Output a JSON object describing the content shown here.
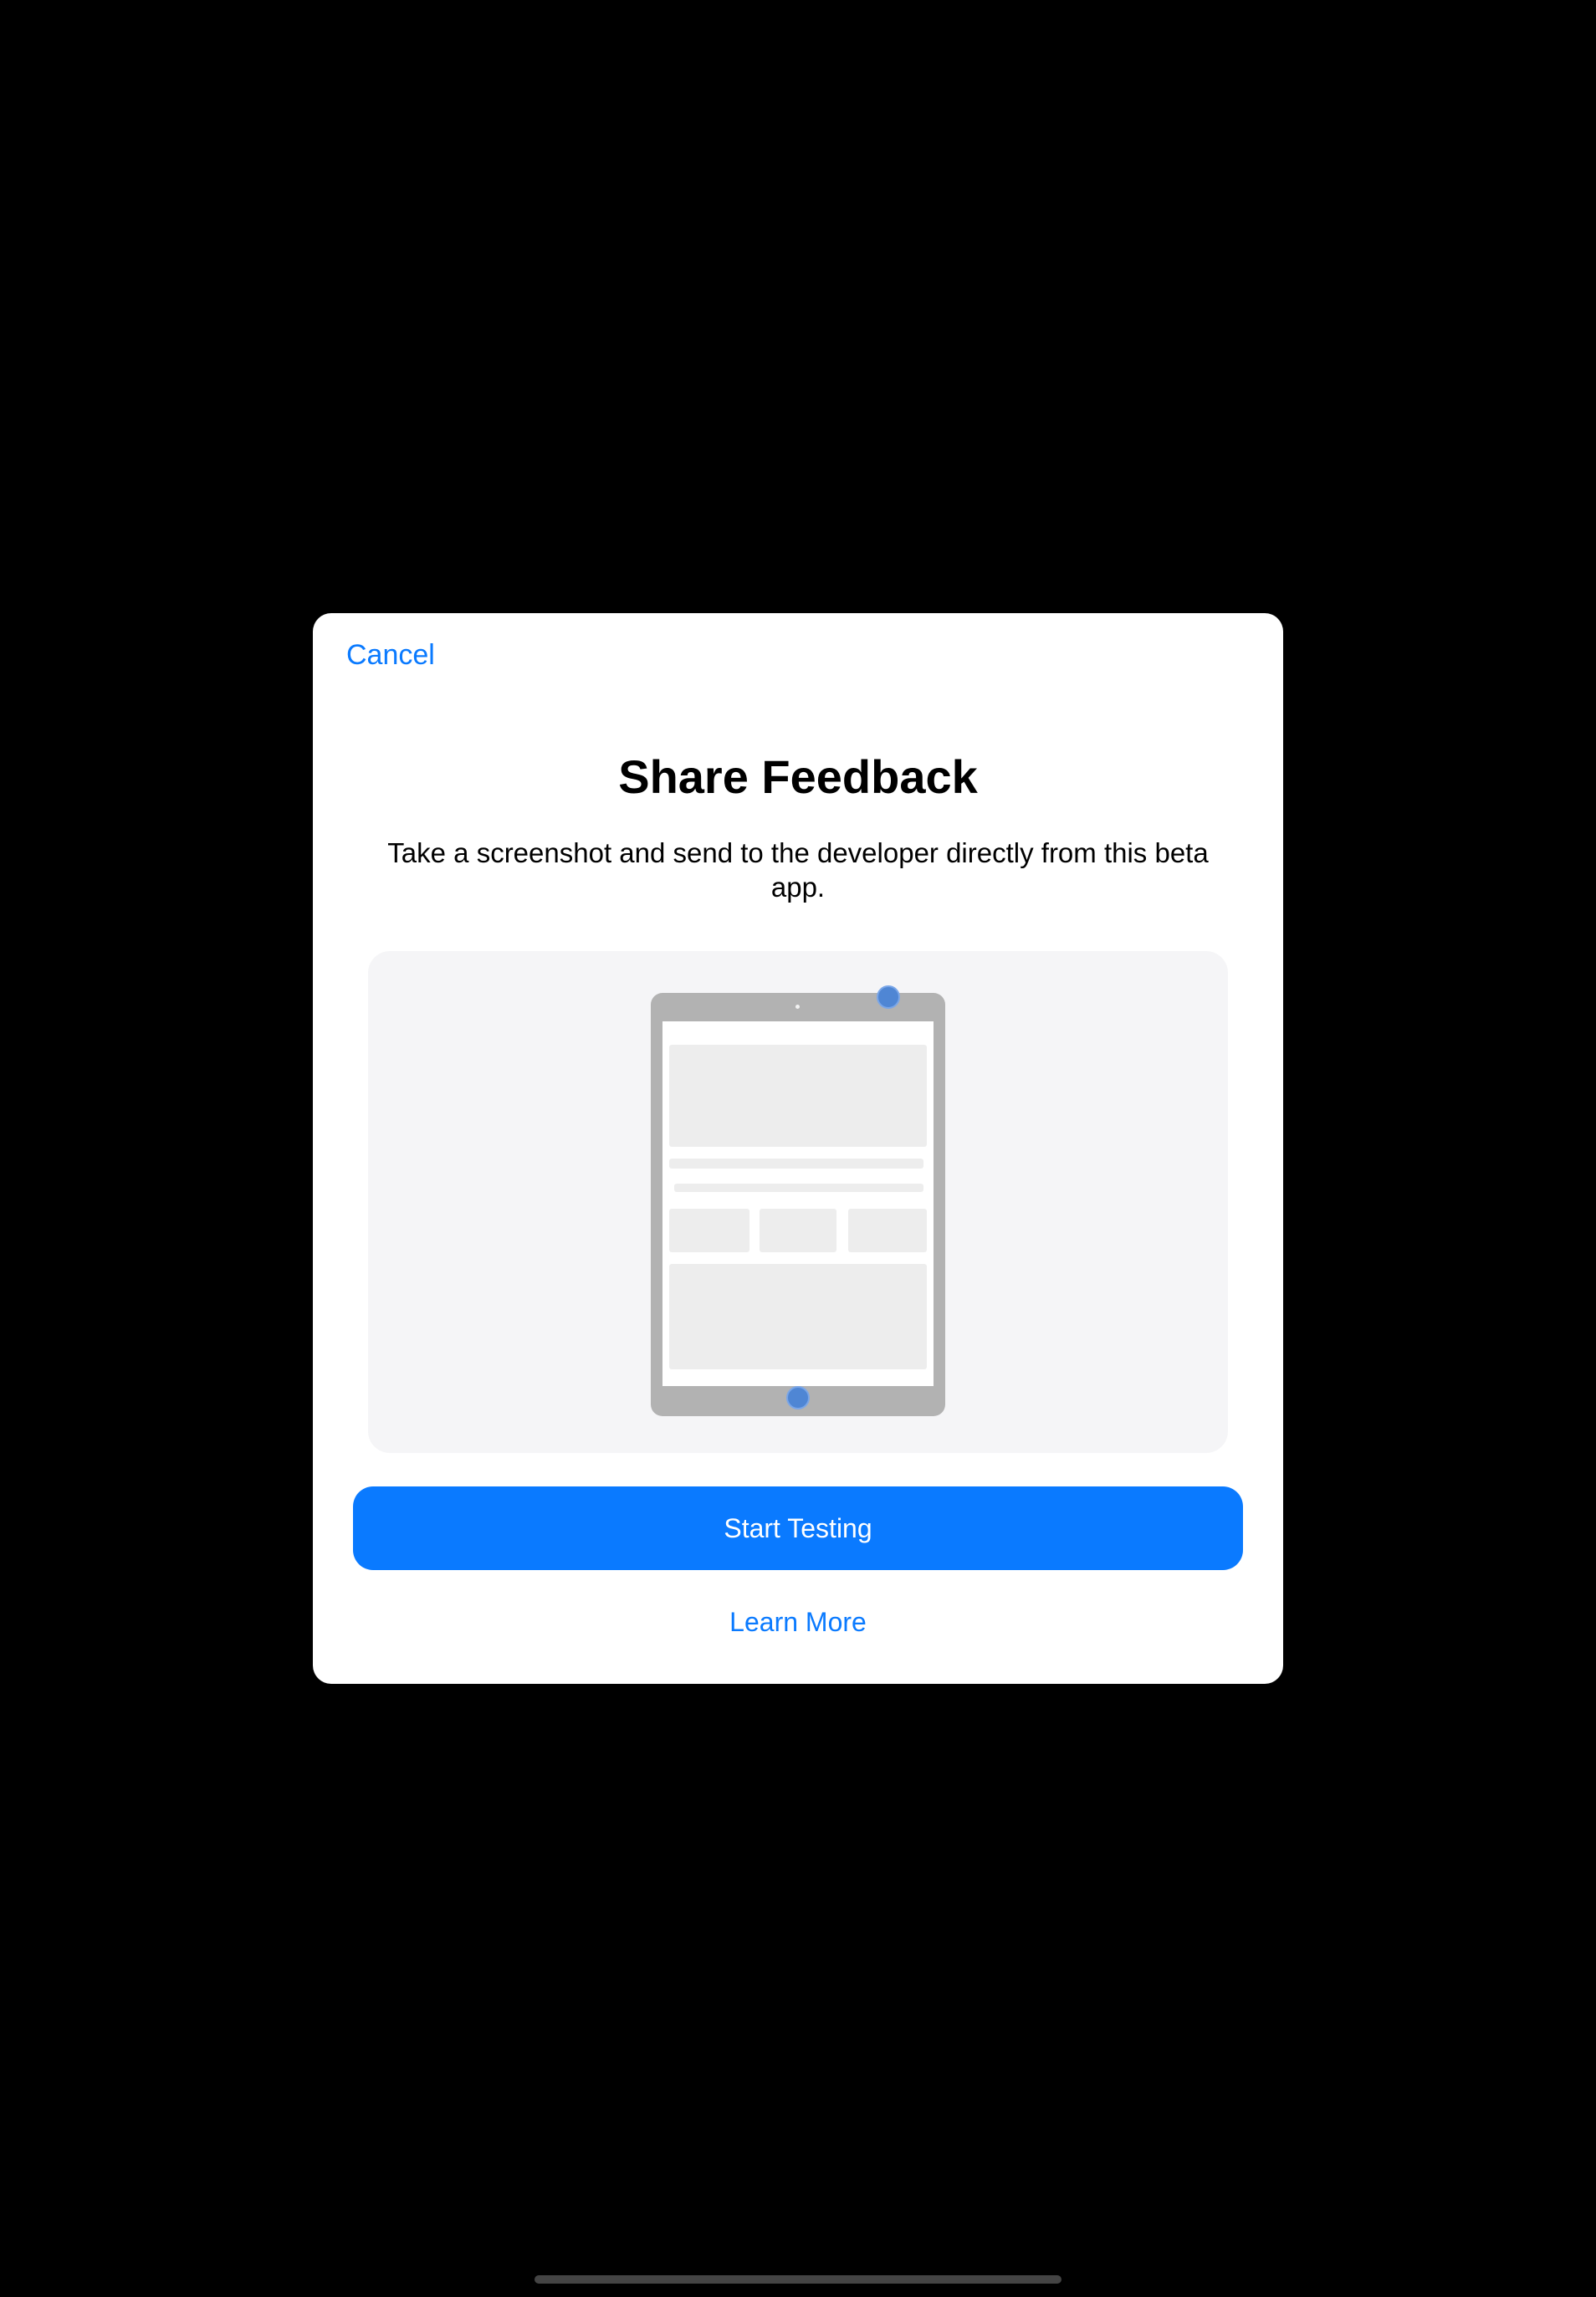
{
  "sheet": {
    "cancel_label": "Cancel",
    "title": "Share Feedback",
    "subtitle": "Take a screenshot and send to the developer directly from this beta app.",
    "primary_button_label": "Start Testing",
    "learn_more_label": "Learn More"
  },
  "illustration": {
    "icon": "ipad-screenshot-gesture-icon",
    "indicator_color": "#4f86d4"
  },
  "colors": {
    "accent": "#0a7aff",
    "background": "#000000",
    "sheet": "#ffffff"
  }
}
